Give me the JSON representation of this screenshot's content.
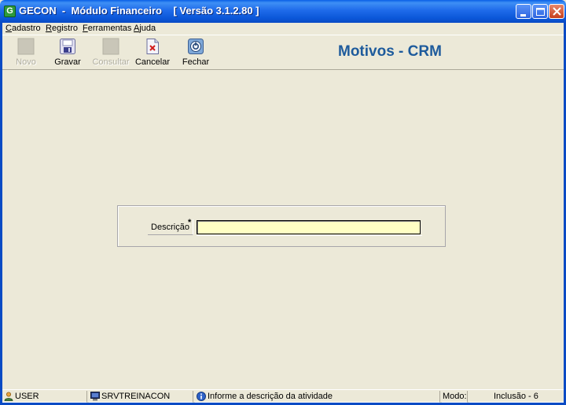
{
  "window": {
    "title": "GECON  -  Módulo Financeiro    [ Versão 3.1.2.80 ]"
  },
  "menu": [
    {
      "first": "C",
      "rest": "adastro"
    },
    {
      "first": "R",
      "rest": "egistro"
    },
    {
      "first": "F",
      "rest": "erramentas"
    },
    {
      "first": "A",
      "rest": "juda"
    }
  ],
  "toolbar": {
    "novo": "Novo",
    "gravar": "Gravar",
    "consultar": "Consultar",
    "cancelar": "Cancelar",
    "fechar": "Fechar"
  },
  "form": {
    "title": "Motivos - CRM",
    "descricao_label": "Descrição",
    "required_mark": "*",
    "descricao_value": ""
  },
  "status": {
    "user": "USER",
    "server": "SRVTREINACON",
    "hint": "Informe a descrição da atividade",
    "mode_label": "Modo:",
    "mode_value": "Inclusão - 6"
  },
  "colors": {
    "title_bar": "#0B56D8",
    "form_title": "#1E5B9C",
    "input_bg": "#FFFFC4",
    "face": "#ECE9D8"
  }
}
